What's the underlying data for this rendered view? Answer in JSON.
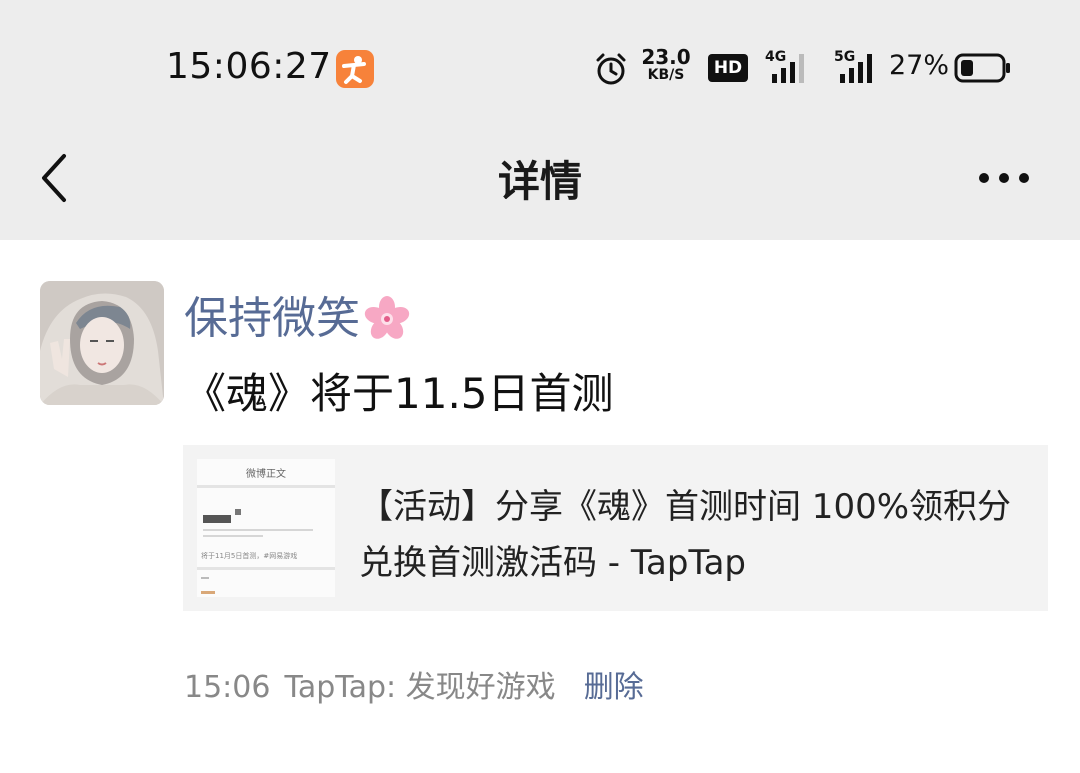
{
  "status_bar": {
    "time": "15:06:27",
    "net_speed_value": "23.0",
    "net_speed_unit": "KB/S",
    "hd_label": "HD",
    "net1_label": "4G",
    "net2_label": "5G",
    "battery_percent": "27%",
    "icons": [
      "app-notification-icon",
      "alarm-icon",
      "hd-voice-icon",
      "signal-icon",
      "battery-icon"
    ]
  },
  "nav": {
    "title": "详情",
    "back_icon": "chevron-left-icon",
    "more_icon": "more-dots-icon"
  },
  "post": {
    "username": "保持微笑",
    "username_emoji": "cherry-blossom-icon",
    "text": "《魂》将于11.5日首测",
    "link": {
      "title": "【活动】分享《魂》首测时间 100%领积分兑换首测激活码 - TapTap",
      "thumb_title": "微博正文",
      "thumb_line1": "将于11月5日首测，#网易游戏"
    },
    "time": "15:06",
    "source": "TapTap: 发现好游戏",
    "delete_label": "删除"
  },
  "colors": {
    "header_bg": "#ededed",
    "username": "#576b95",
    "link_card_bg": "#f3f3f3",
    "meta_text": "#888888"
  }
}
